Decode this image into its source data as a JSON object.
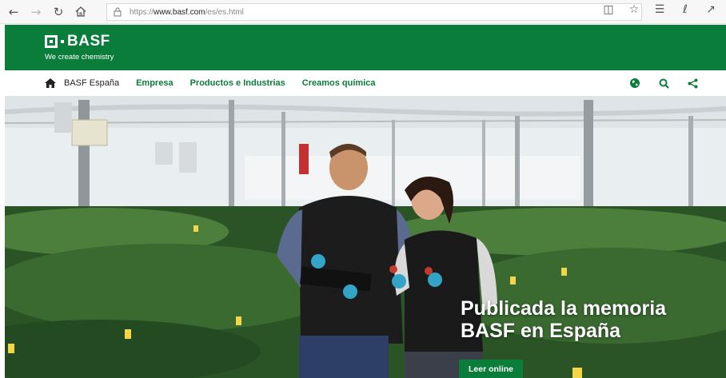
{
  "browser": {
    "url_prefix": "https://",
    "url_domain": "www.basf.com",
    "url_path": "/es/es.html",
    "icons": [
      "back-icon",
      "forward-icon",
      "refresh-icon",
      "home-icon",
      "lock-icon",
      "reading-view-icon",
      "favorite-star-icon",
      "favorites-list-icon",
      "pen-icon",
      "share-icon"
    ]
  },
  "header": {
    "logo_text": "BASF",
    "tagline": "We create chemistry",
    "brand_color": "#0a7d3b"
  },
  "nav": {
    "items": [
      {
        "label": "BASF España"
      },
      {
        "label": "Empresa"
      },
      {
        "label": "Productos e Industrias"
      },
      {
        "label": "Creamos química"
      }
    ],
    "tools": [
      "globe-icon",
      "search-icon",
      "share-icon"
    ]
  },
  "hero": {
    "headline_line1": "Publicada la memoria",
    "headline_line2": "BASF en España",
    "cta_label": "Leer online"
  }
}
